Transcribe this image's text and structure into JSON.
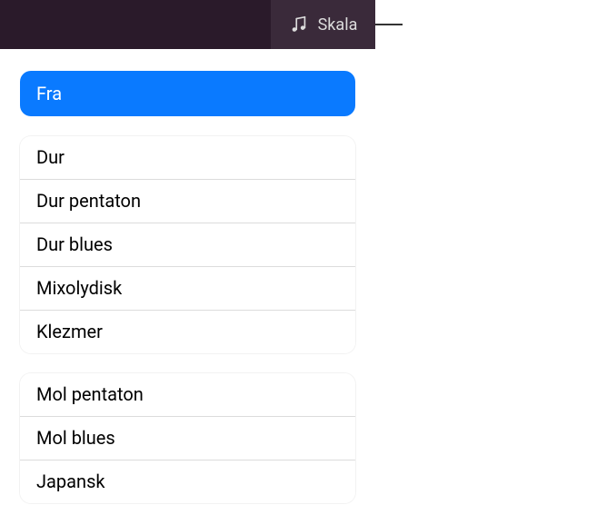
{
  "header": {
    "scale_label": "Skala"
  },
  "selected": {
    "label": "Fra"
  },
  "group1": {
    "items": [
      {
        "label": "Dur"
      },
      {
        "label": "Dur pentaton"
      },
      {
        "label": "Dur blues"
      },
      {
        "label": "Mixolydisk"
      },
      {
        "label": "Klezmer"
      }
    ]
  },
  "group2": {
    "items": [
      {
        "label": "Mol pentaton"
      },
      {
        "label": "Mol blues"
      },
      {
        "label": "Japansk"
      }
    ]
  },
  "colors": {
    "selected_bg": "#0a7aff",
    "topbar_bg": "#2a1a2a",
    "button_bg": "#3a2a3a"
  }
}
